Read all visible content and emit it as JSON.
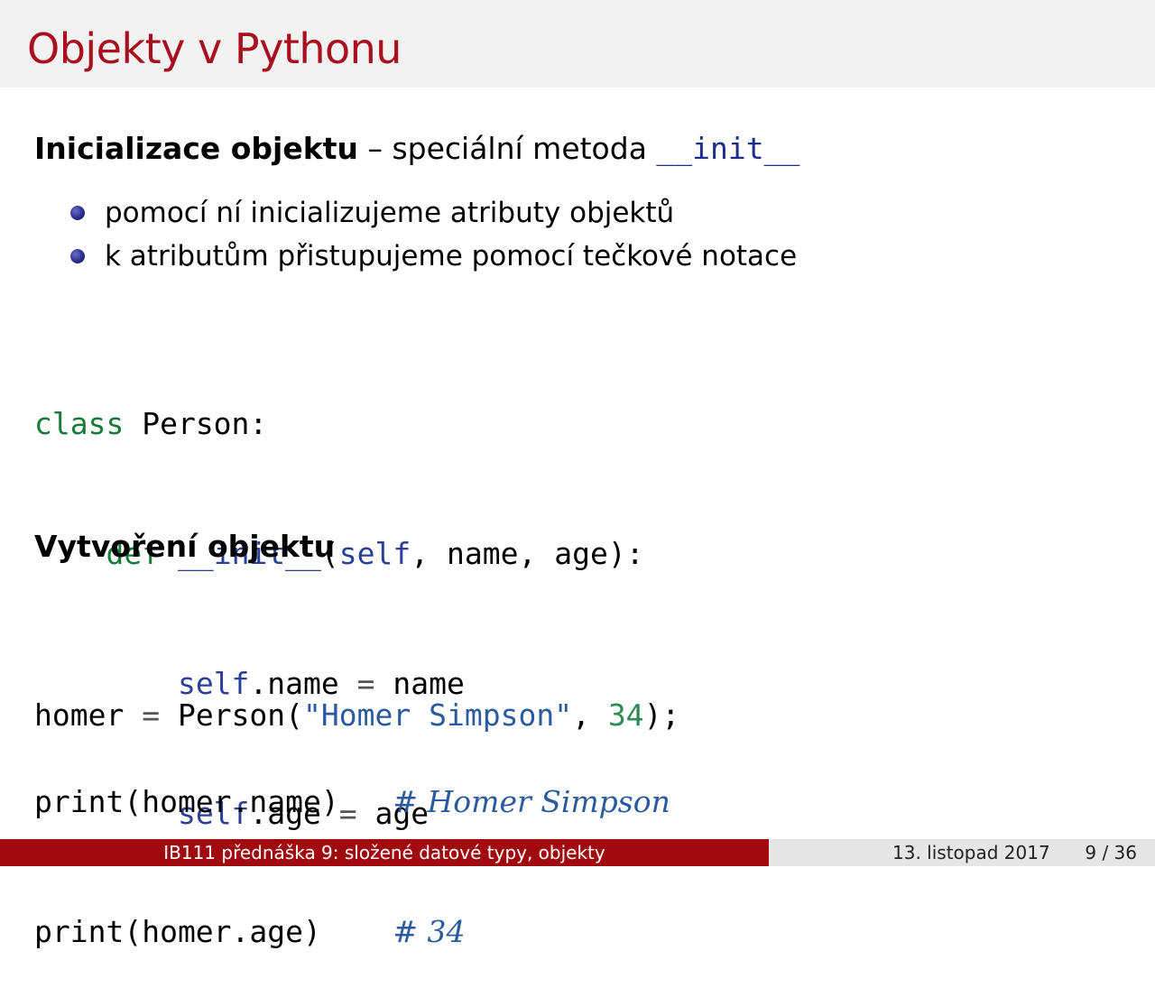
{
  "slide": {
    "title": "Objekty v Pythonu"
  },
  "section1": {
    "heading_bold": "Inicializace objektu",
    "heading_rest": " – speciální metoda ",
    "heading_code": "__init__",
    "bullets": [
      "pomocí ní inicializujeme atributy objektů",
      "k atributům přistupujeme pomocí tečkové notace"
    ]
  },
  "code1": {
    "line1": {
      "kw": "class",
      "rest": " Person:"
    },
    "line2": {
      "indent": "    ",
      "kw": "def",
      "sp": " ",
      "fn": "__init__",
      "open": "(",
      "self": "self",
      "rest": ", name, age):"
    },
    "line3": {
      "indent": "        ",
      "self": "self",
      "attr": ".name ",
      "op": "=",
      "rest": " name"
    },
    "line4": {
      "indent": "        ",
      "self": "self",
      "attr": ".age ",
      "op": "=",
      "rest": " age"
    }
  },
  "section2": {
    "heading": "Vytvoření objektu"
  },
  "code2": {
    "var": "homer ",
    "op": "=",
    "call": " Person(",
    "str": "\"Homer Simpson\"",
    "comma": ", ",
    "num": "34",
    "close": ");"
  },
  "code3": {
    "line1": {
      "code": "print(homer.name)   ",
      "comment": "# Homer Simpson"
    },
    "line2": {
      "code": "print(homer.age)    ",
      "comment": "# 34"
    }
  },
  "footer": {
    "lecture": "IB111 přednáška 9: složené datové typy, objekty",
    "date": "13. listopad 2017",
    "page": "9 / 36"
  },
  "colors": {
    "title": "#a81020",
    "footer_left_bg": "#a00a0f",
    "keyword": "#1a7a3a",
    "self": "#2a3f9a",
    "string": "#2a5aa0"
  }
}
